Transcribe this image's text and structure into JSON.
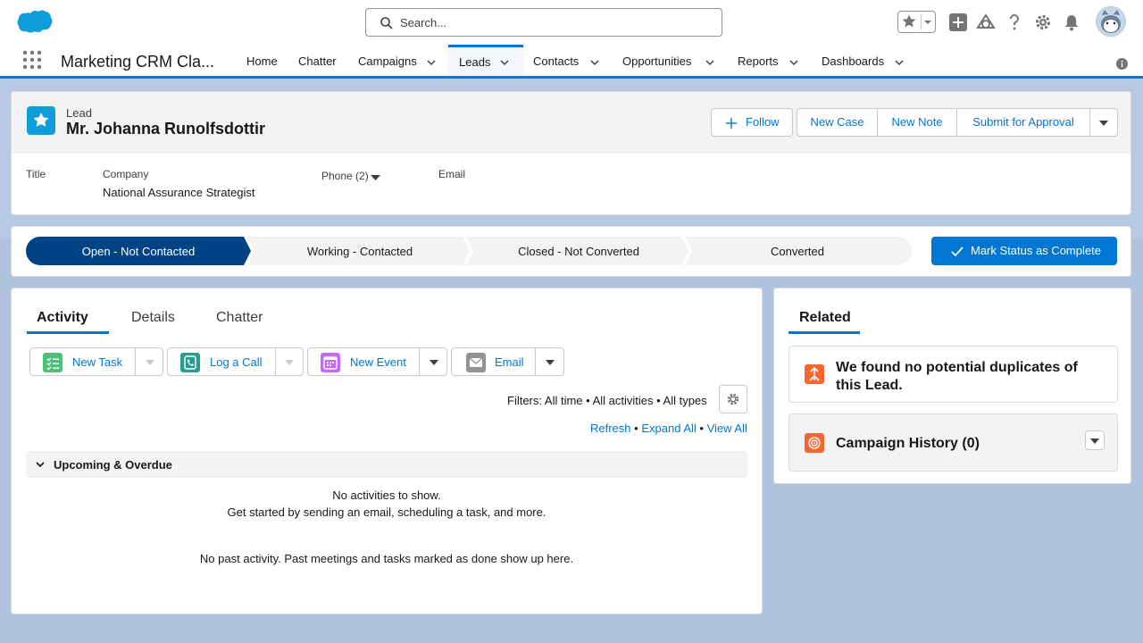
{
  "header": {
    "search_placeholder": "Search...",
    "icons": [
      "salesforce-cloud-icon",
      "search-icon",
      "star-icon",
      "chevron-down-icon",
      "add-icon",
      "trailhead-icon",
      "help-icon",
      "setup-gear-icon",
      "notifications-bell-icon",
      "avatar-icon"
    ]
  },
  "nav": {
    "app_name": "Marketing CRM Cla...",
    "items": [
      {
        "label": "Home"
      },
      {
        "label": "Chatter"
      },
      {
        "label": "Campaigns"
      },
      {
        "label": "Leads"
      },
      {
        "label": "Contacts"
      },
      {
        "label": "Opportunities"
      },
      {
        "label": "Reports"
      },
      {
        "label": "Dashboards"
      }
    ],
    "active": "Leads"
  },
  "record": {
    "object_label": "Lead",
    "name": "Mr. Johanna Runolfsdottir",
    "actions": {
      "follow": "Follow",
      "new_case": "New Case",
      "new_note": "New Note",
      "submit": "Submit for Approval"
    },
    "fields": {
      "title_label": "Title",
      "company_label": "Company",
      "company_value": "National Assurance Strategist",
      "phone_label": "Phone (2)",
      "email_label": "Email"
    }
  },
  "path": {
    "stages": [
      "Open - Not Contacted",
      "Working - Contacted",
      "Closed - Not Converted",
      "Converted"
    ],
    "current_stage": "Open - Not Contacted",
    "mark_button": "Mark Status as Complete",
    "colors": {
      "current": "#014486",
      "inactive": "#f3f3f3"
    }
  },
  "activity": {
    "tabs": [
      "Activity",
      "Details",
      "Chatter"
    ],
    "active_tab": "Activity",
    "publisher": {
      "new_task": "New Task",
      "log_call": "Log a Call",
      "new_event": "New Event",
      "email": "Email"
    },
    "filters": "Filters: All time • All activities • All types",
    "links": {
      "refresh": "Refresh",
      "expand_all": "Expand All",
      "view_all": "View All",
      "sep": "•"
    },
    "upcoming_title": "Upcoming & Overdue",
    "empty_line1": "No activities to show.",
    "empty_line2": "Get started by sending an email, scheduling a task, and more.",
    "past_msg": "No past activity. Past meetings and tasks marked as done show up here."
  },
  "related": {
    "tab": "Related",
    "duplicates": "We found no potential duplicates of this Lead.",
    "campaign_history": "Campaign History (0)"
  },
  "colors": {
    "brand": "#0176d3",
    "lead_icon": "#0d9dda",
    "task_icon": "#4bc076",
    "call_icon": "#2a9d8f",
    "event_icon": "#cb65ff",
    "email_icon": "#939393",
    "duplicate_icon": "#f5672e"
  }
}
